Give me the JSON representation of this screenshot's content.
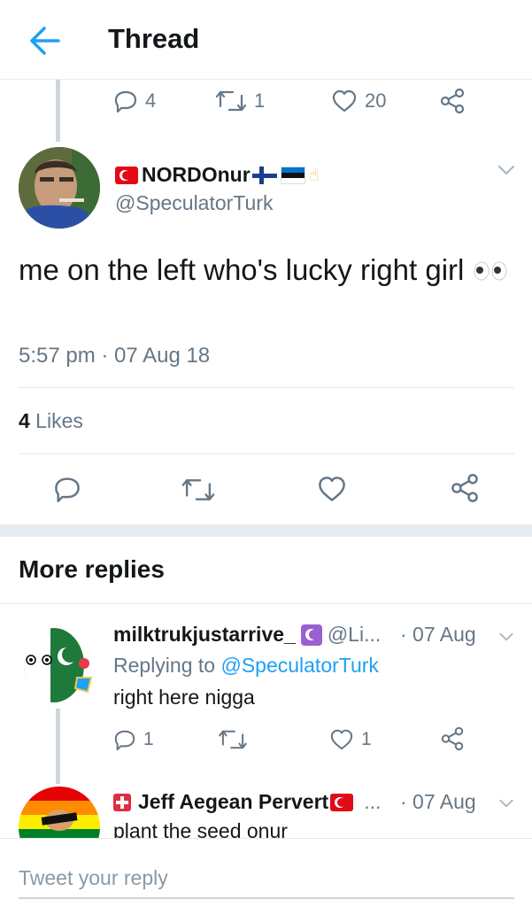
{
  "header": {
    "title": "Thread"
  },
  "parent_actions": {
    "replies": "4",
    "retweets": "1",
    "likes": "20"
  },
  "main_tweet": {
    "display_name": "NORDOnur",
    "handle": "@SpeculatorTurk",
    "text": "me on the left who's lucky right girl",
    "timestamp": "5:57 pm · 07 Aug 18",
    "likes_count": "4",
    "likes_label": " Likes"
  },
  "more_replies": {
    "title": "More replies"
  },
  "replies": [
    {
      "display_name": "milktrukjustarrive_",
      "handle": "@Li...",
      "date": "· 07 Aug",
      "replying_prefix": "Replying to ",
      "replying_to": "@SpeculatorTurk",
      "text": "right here nigga",
      "reply_count": "1",
      "like_count": "1"
    },
    {
      "display_name": "Jeff Aegean Pervert",
      "handle": "...",
      "date": "· 07 Aug",
      "text": "plant the seed onur"
    }
  ],
  "compose": {
    "placeholder": "Tweet your reply"
  },
  "colors": {
    "accent": "#1da1f2",
    "muted": "#657786",
    "divider": "#e1e8ed"
  }
}
